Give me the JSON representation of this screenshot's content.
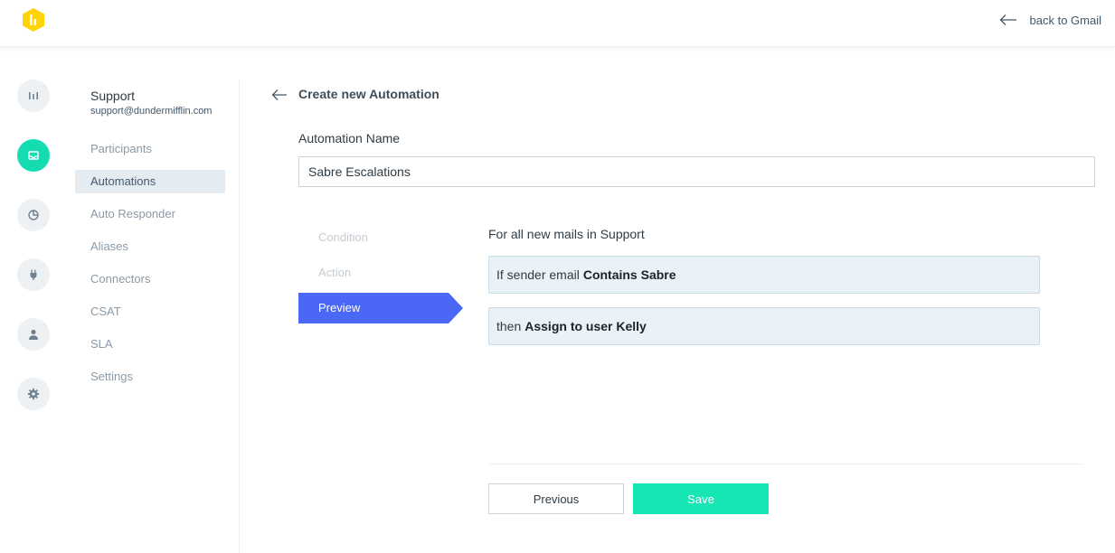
{
  "header": {
    "back_label": "back to Gmail"
  },
  "rail": {
    "items": [
      {
        "icon": "bar-chart-icon",
        "active": false
      },
      {
        "icon": "inbox-icon",
        "active": true
      },
      {
        "icon": "pie-chart-icon",
        "active": false
      },
      {
        "icon": "plug-icon",
        "active": false
      },
      {
        "icon": "user-icon",
        "active": false
      },
      {
        "icon": "gear-icon",
        "active": false
      }
    ],
    "accent_color": "#15dcb0"
  },
  "sidebar": {
    "inbox_name": "Support",
    "inbox_email": "support@dundermifflin.com",
    "items": [
      {
        "label": "Participants"
      },
      {
        "label": "Automations",
        "active": true
      },
      {
        "label": "Auto Responder"
      },
      {
        "label": "Aliases"
      },
      {
        "label": "Connectors"
      },
      {
        "label": "CSAT"
      },
      {
        "label": "SLA"
      },
      {
        "label": "Settings"
      }
    ]
  },
  "main": {
    "title": "Create new Automation",
    "name_label": "Automation Name",
    "name_value": "Sabre Escalations",
    "steps": [
      {
        "label": "Condition"
      },
      {
        "label": "Action"
      },
      {
        "label": "Preview",
        "active": true
      }
    ],
    "preview": {
      "lead": "For all new mails in Support",
      "condition_prefix": "If sender email",
      "condition_bold": "Contains Sabre",
      "action_prefix": "then",
      "action_bold": "Assign to user Kelly"
    },
    "buttons": {
      "previous": "Previous",
      "save": "Save"
    },
    "colors": {
      "step_active": "#4a67f6",
      "save_button": "#15e6b4"
    }
  }
}
